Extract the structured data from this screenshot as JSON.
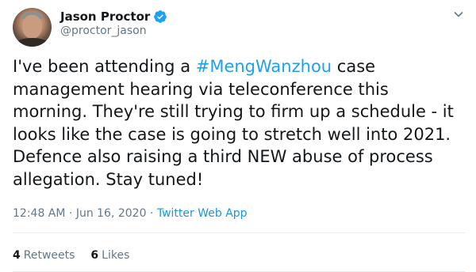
{
  "author": {
    "display_name": "Jason Proctor",
    "handle": "@proctor_jason",
    "verified": true
  },
  "tweet": {
    "text_before": "I've been attending a ",
    "hashtag": "#MengWanzhou",
    "text_after": " case management hearing via teleconference this morning. They're still trying to firm up a schedule - it looks like the case is going to stretch well into 2021. Defence also raising a third NEW abuse of process allegation. Stay tuned!"
  },
  "meta": {
    "time": "12:48 AM",
    "separator": " · ",
    "date": "Jun 16, 2020",
    "source": "Twitter Web App"
  },
  "stats": {
    "retweets_count": "4",
    "retweets_label": "Retweets",
    "likes_count": "6",
    "likes_label": "Likes"
  },
  "icons": {
    "verified": "verified-badge-icon",
    "caret": "chevron-down-icon"
  },
  "colors": {
    "link": "#1da1f2",
    "secondary_text": "#657786",
    "primary_text": "#14171a"
  }
}
